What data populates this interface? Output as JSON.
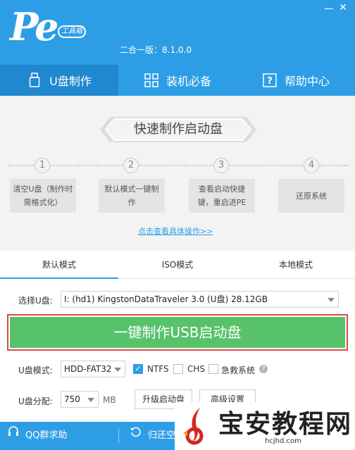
{
  "header": {
    "logo_text": "Pe",
    "logo_badge": "工具箱",
    "version": "二合一版：8.1.0.0"
  },
  "tabs": [
    {
      "label": "U盘制作",
      "icon": "usb-drive-icon"
    },
    {
      "label": "装机必备",
      "icon": "apps-grid-icon"
    },
    {
      "label": "帮助中心",
      "icon": "help-icon"
    }
  ],
  "panel": {
    "banner": "快速制作启动盘",
    "steps": [
      {
        "num": "1",
        "text": "清空U盘（制作时需格式化）"
      },
      {
        "num": "2",
        "text": "默认模式一键制作"
      },
      {
        "num": "3",
        "text": "查看启动快捷键，重启进PE"
      },
      {
        "num": "4",
        "text": "还原系统"
      }
    ],
    "detail_link": "点击查看具体操作>>"
  },
  "modes": [
    "默认模式",
    "ISO模式",
    "本地模式"
  ],
  "form": {
    "usb_label": "选择U盘:",
    "usb_value": "I: (hd1) KingstonDataTraveler 3.0 (U盘) 28.12GB",
    "make_button": "一键制作USB启动盘",
    "mode_label": "U盘模式:",
    "mode_value": "HDD-FAT32",
    "ntfs_label": "NTFS",
    "ntfs_checked": true,
    "chs_label": "CHS",
    "rescue_label": "急救系统",
    "partition_label": "U盘分配:",
    "partition_value": "750",
    "partition_unit": "MB",
    "upgrade_button": "升级启动盘",
    "advanced_button": "高级设置"
  },
  "footer": {
    "qq_label": "QQ群求助",
    "restore_label": "归还空"
  },
  "watermark": {
    "title": "宝安教程网",
    "url": "hcjhd.com"
  },
  "colors": {
    "primary": "#2d9ee6",
    "active_tab": "#1f88cf",
    "make_button": "#57c26a",
    "highlight_frame": "#d94a4a"
  }
}
